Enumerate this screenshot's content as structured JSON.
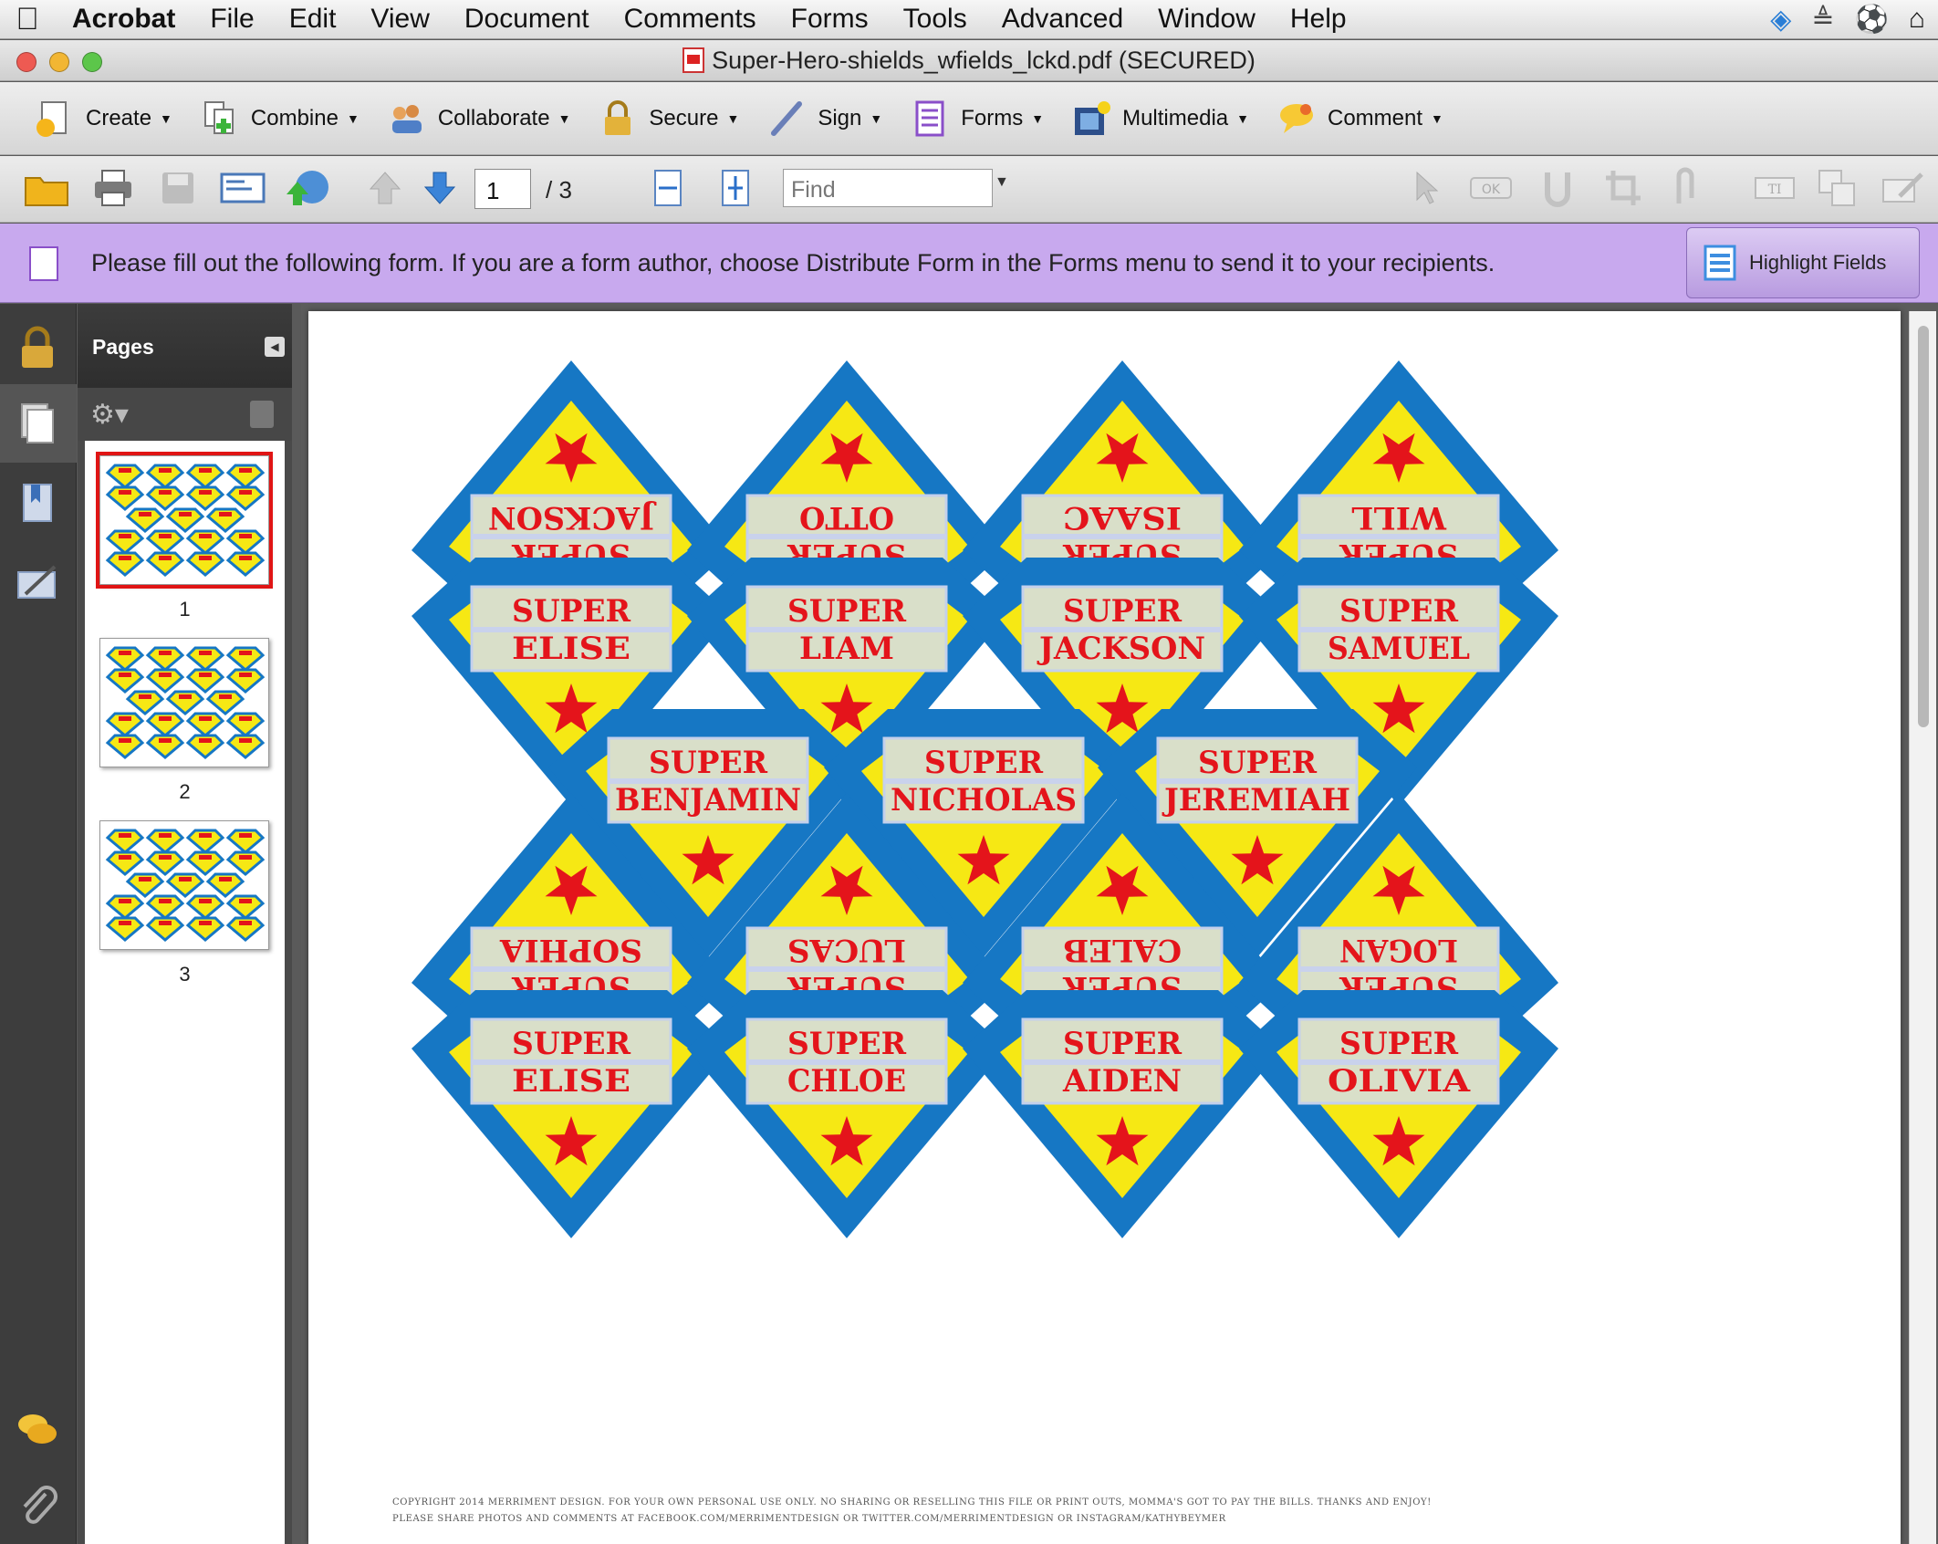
{
  "menubar": {
    "app": "Acrobat",
    "items": [
      "File",
      "Edit",
      "View",
      "Document",
      "Comments",
      "Forms",
      "Tools",
      "Advanced",
      "Window",
      "Help"
    ]
  },
  "window": {
    "title": "Super-Hero-shields_wfields_lckd.pdf (SECURED)"
  },
  "tasks": [
    {
      "label": "Create",
      "icon": "create-icon"
    },
    {
      "label": "Combine",
      "icon": "combine-icon"
    },
    {
      "label": "Collaborate",
      "icon": "collaborate-icon"
    },
    {
      "label": "Secure",
      "icon": "lock-icon"
    },
    {
      "label": "Sign",
      "icon": "pen-icon"
    },
    {
      "label": "Forms",
      "icon": "form-icon"
    },
    {
      "label": "Multimedia",
      "icon": "film-icon"
    },
    {
      "label": "Comment",
      "icon": "speech-bubble-icon"
    }
  ],
  "toolbar": {
    "page_current": "1",
    "page_total": "/ 3",
    "find_placeholder": "Find"
  },
  "formbar": {
    "message": "Please fill out the following form. If you are a form author, choose Distribute Form in the Forms menu to send it to your recipients.",
    "highlight_label": "Highlight Fields"
  },
  "pages_panel": {
    "title": "Pages",
    "thumb_labels": [
      "1",
      "2",
      "3"
    ],
    "selected_page": 1
  },
  "document": {
    "shields": [
      {
        "line1": "SUPER",
        "line2": "JACKSON",
        "flipped": true
      },
      {
        "line1": "SUPER",
        "line2": "OTTO",
        "flipped": true
      },
      {
        "line1": "SUPER",
        "line2": "ISAAC",
        "flipped": true
      },
      {
        "line1": "SUPER",
        "line2": "WILL",
        "flipped": true
      },
      {
        "line1": "SUPER",
        "line2": "ELISE",
        "flipped": false
      },
      {
        "line1": "SUPER",
        "line2": "LIAM",
        "flipped": false
      },
      {
        "line1": "SUPER",
        "line2": "JACKSON",
        "flipped": false
      },
      {
        "line1": "SUPER",
        "line2": "SAMUEL",
        "flipped": false
      },
      {
        "line1": "SUPER",
        "line2": "BENJAMIN",
        "flipped": false
      },
      {
        "line1": "SUPER",
        "line2": "NICHOLAS",
        "flipped": false
      },
      {
        "line1": "SUPER",
        "line2": "JEREMIAH",
        "flipped": false
      },
      {
        "line1": "SUPER",
        "line2": "SOPHIA",
        "flipped": true
      },
      {
        "line1": "SUPER",
        "line2": "LUCAS",
        "flipped": true
      },
      {
        "line1": "SUPER",
        "line2": "CALEB",
        "flipped": true
      },
      {
        "line1": "SUPER",
        "line2": "LOGAN",
        "flipped": true
      },
      {
        "line1": "SUPER",
        "line2": "ELISE",
        "flipped": false
      },
      {
        "line1": "SUPER",
        "line2": "CHLOE",
        "flipped": false
      },
      {
        "line1": "SUPER",
        "line2": "AIDEN",
        "flipped": false
      },
      {
        "line1": "SUPER",
        "line2": "OLIVIA",
        "flipped": false
      }
    ],
    "footer_line1": "COPYRIGHT 2014 MERRIMENT DESIGN. FOR YOUR OWN PERSONAL USE ONLY. NO SHARING OR RESELLING THIS FILE OR PRINT OUTS, MOMMA'S GOT TO PAY THE BILLS. THANKS AND ENJOY!",
    "footer_line2": "PLEASE SHARE PHOTOS AND COMMENTS AT FACEBOOK.COM/MERRIMENTDESIGN OR TWITTER.COM/MERRIMENTDESIGN OR INSTAGRAM/KATHYBEYMER"
  },
  "colors": {
    "shield_blue": "#1677c4",
    "shield_yellow": "#f6e814",
    "star_red": "#e4141b",
    "form_bar": "#c8a9ee"
  }
}
